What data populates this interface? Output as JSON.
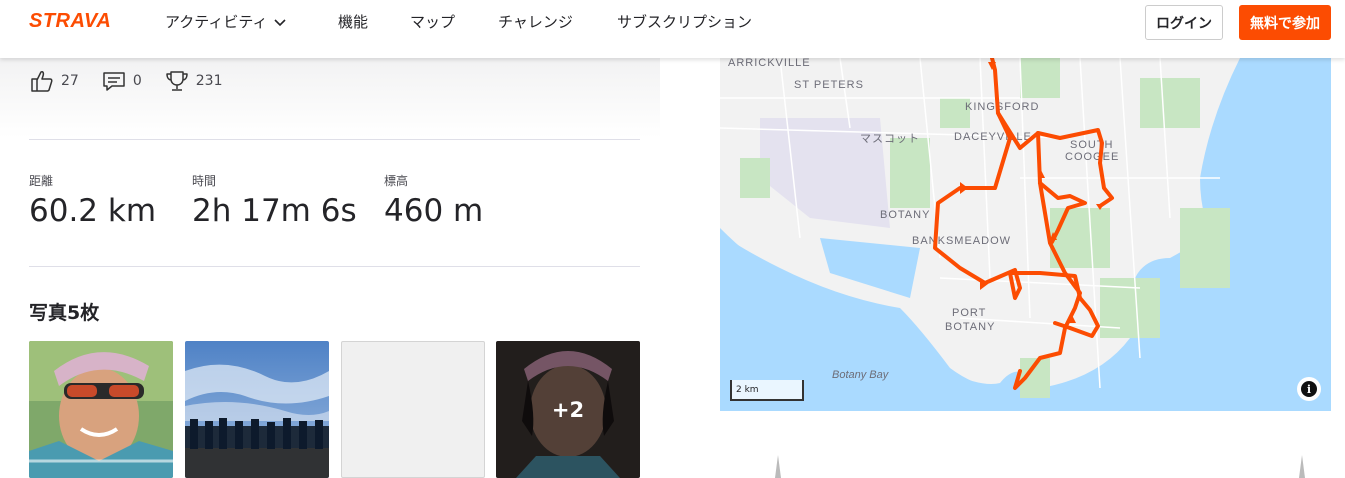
{
  "header": {
    "logo": "STRAVA",
    "nav": [
      {
        "label": "アクティビティ"
      },
      {
        "label": "機能"
      },
      {
        "label": "マップ"
      },
      {
        "label": "チャレンジ"
      },
      {
        "label": "サブスクリプション"
      }
    ],
    "login_label": "ログイン",
    "join_label": "無料で参加"
  },
  "social": {
    "kudos": "27",
    "comments": "0",
    "achievements": "231"
  },
  "stats": [
    {
      "label": "距離",
      "value": "60.2 km"
    },
    {
      "label": "時間",
      "value": "2h 17m 6s"
    },
    {
      "label": "標高",
      "value": "460 m"
    }
  ],
  "photos": {
    "title": "写真5枚",
    "more_label": "+2"
  },
  "map": {
    "labels": [
      "ARRICKVILLE",
      "ST PETERS",
      "KINGSFORD",
      "マスコット",
      "DACEYVILLE",
      "SOUTH",
      "COOGEE",
      "BOTANY",
      "BANKSMEADOW",
      "PORT",
      "BOTANY",
      "Botany Bay"
    ],
    "scale": "2 km",
    "route_color": "#fc4c02",
    "water_color": "#aadaff",
    "land_color": "#f2f2f2"
  }
}
